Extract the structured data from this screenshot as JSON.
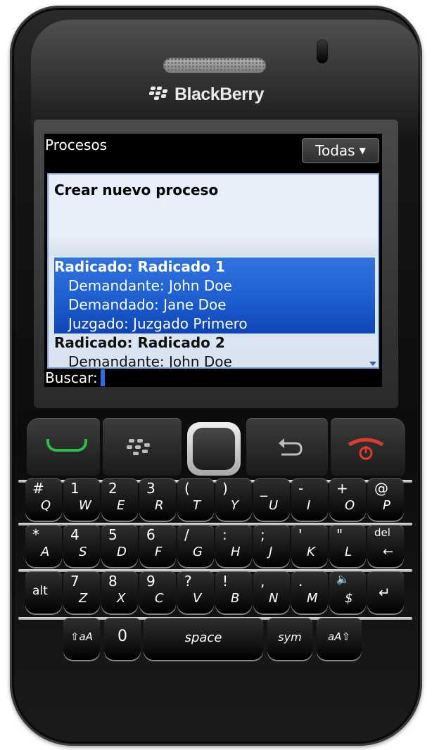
{
  "device": {
    "brand": "BlackBerry"
  },
  "screen": {
    "title": "Procesos",
    "filter": {
      "label": "Todas",
      "caret": "▼"
    },
    "list": {
      "create_label": "Crear nuevo proceso",
      "items": [
        {
          "head": "Radicado: Radicado 1",
          "lines": [
            "Demandante: John Doe",
            "Demandado: Jane Doe",
            "Juzgado: Juzgado Primero"
          ],
          "selected": true
        },
        {
          "head": "Radicado: Radicado 2",
          "lines": [
            "Demandante: John Doe"
          ],
          "selected": false
        }
      ]
    },
    "search": {
      "label": "Buscar:",
      "value": ""
    }
  },
  "keyboard": {
    "rows": [
      [
        {
          "alt": "#",
          "main": "Q"
        },
        {
          "alt": "1",
          "main": "W"
        },
        {
          "alt": "2",
          "main": "E"
        },
        {
          "alt": "3",
          "main": "R"
        },
        {
          "alt": "(",
          "main": "T"
        },
        {
          "alt": ")",
          "main": "Y"
        },
        {
          "alt": "_",
          "main": "U"
        },
        {
          "alt": "-",
          "main": "I"
        },
        {
          "alt": "+",
          "main": "O"
        },
        {
          "alt": "@",
          "main": "P"
        }
      ],
      [
        {
          "alt": "*",
          "main": "A"
        },
        {
          "alt": "4",
          "main": "S"
        },
        {
          "alt": "5",
          "main": "D"
        },
        {
          "alt": "6",
          "main": "F"
        },
        {
          "alt": "/",
          "main": "G"
        },
        {
          "alt": ":",
          "main": "H"
        },
        {
          "alt": ";",
          "main": "J"
        },
        {
          "alt": "'",
          "main": "K"
        },
        {
          "alt": "\"",
          "main": "L"
        },
        {
          "alt": "del",
          "main": "←"
        }
      ],
      [
        {
          "alt": "alt",
          "main": ""
        },
        {
          "alt": "7",
          "main": "Z"
        },
        {
          "alt": "8",
          "main": "X"
        },
        {
          "alt": "9",
          "main": "C"
        },
        {
          "alt": "?",
          "main": "V"
        },
        {
          "alt": "!",
          "main": "B"
        },
        {
          "alt": ",",
          "main": "N"
        },
        {
          "alt": ".",
          "main": "M"
        },
        {
          "alt": "🔈",
          "main": "$"
        },
        {
          "alt": "↵",
          "main": ""
        }
      ]
    ],
    "bottom": {
      "shift_left": "⇧aA",
      "zero": "0",
      "space": "space",
      "sym": "sym",
      "shift_right": "aA⇧"
    }
  }
}
